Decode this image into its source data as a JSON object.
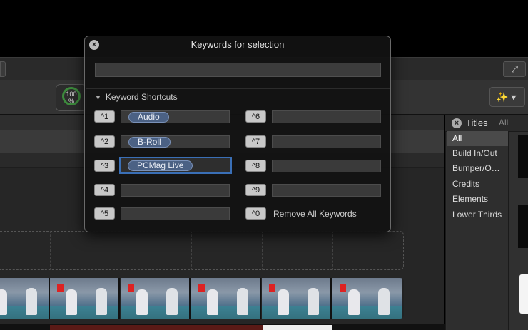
{
  "app": {
    "percent_badge": "100\n%",
    "titles_panel": {
      "title": "Titles",
      "filter": "All",
      "items": [
        "All",
        "Build In/Out",
        "Bumper/O…",
        "Credits",
        "Elements",
        "Lower Thirds"
      ]
    }
  },
  "dialog": {
    "title": "Keywords for selection",
    "keyword_field_value": "",
    "section_label": "Keyword Shortcuts",
    "left_shortcuts": [
      {
        "key": "^1",
        "keyword": "Audio"
      },
      {
        "key": "^2",
        "keyword": "B-Roll"
      },
      {
        "key": "^3",
        "keyword": "PCMag Live"
      },
      {
        "key": "^4",
        "keyword": ""
      },
      {
        "key": "^5",
        "keyword": ""
      }
    ],
    "right_shortcuts": [
      {
        "key": "^6",
        "keyword": ""
      },
      {
        "key": "^7",
        "keyword": ""
      },
      {
        "key": "^8",
        "keyword": ""
      },
      {
        "key": "^9",
        "keyword": ""
      }
    ],
    "remove_key": "^0",
    "remove_label": "Remove All Keywords"
  },
  "icons": {
    "close": "close-icon",
    "fullscreen": "fullscreen-icon",
    "wand": "magic-wand-icon"
  },
  "colors": {
    "keyword_pill": "#4b6184",
    "focus_ring": "#3a6fb6"
  }
}
